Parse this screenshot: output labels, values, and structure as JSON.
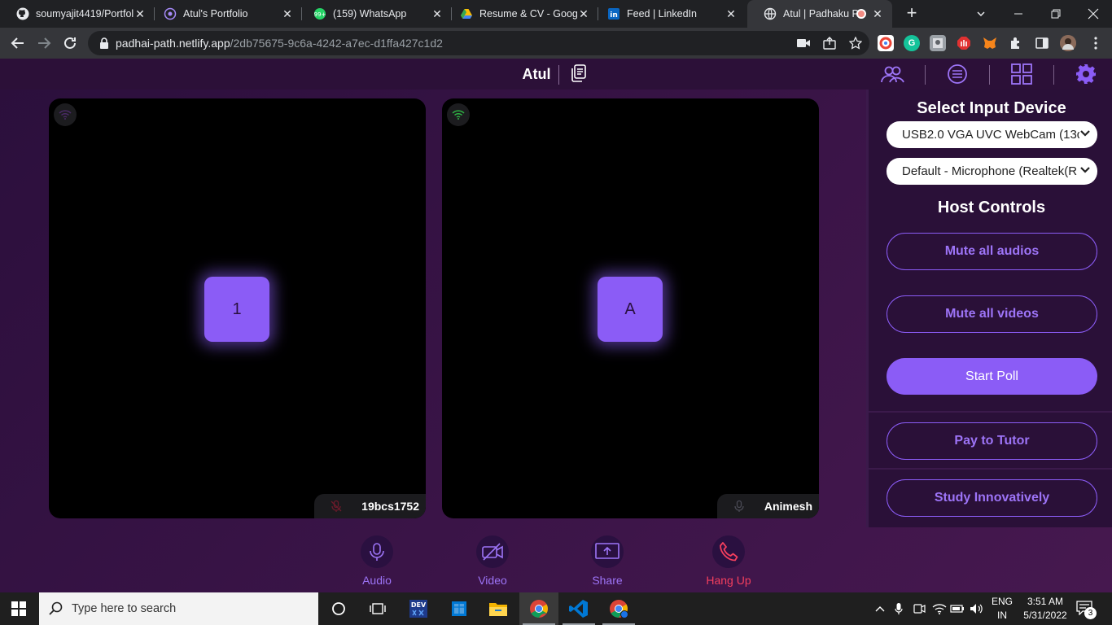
{
  "browser": {
    "tabs": [
      {
        "title": "soumyajit4419/Portfol",
        "icon": "github-icon"
      },
      {
        "title": "Atul's Portfolio",
        "icon": "portfolio-icon"
      },
      {
        "title": "(159) WhatsApp",
        "icon": "whatsapp-icon"
      },
      {
        "title": "Resume & CV - Googl",
        "icon": "google-drive-icon"
      },
      {
        "title": "Feed | LinkedIn",
        "icon": "linkedin-icon"
      },
      {
        "title": "Atul | Padhaku Pa",
        "icon": "globe-icon",
        "active": true
      }
    ],
    "url_host": "padhai-path.netlify.app",
    "url_path": "/2db75675-9c6a-4242-a7ec-d1ffa427c1d2"
  },
  "app": {
    "host_name": "Atul",
    "participants": [
      {
        "avatar": "1",
        "name": "19bcs1752",
        "mic": "muted",
        "signal": "weak"
      },
      {
        "avatar": "A",
        "name": "Animesh",
        "mic": "on",
        "signal": "strong"
      }
    ],
    "panel_tabs": [
      "participants-icon",
      "chat-icon",
      "grid-icon",
      "settings-icon"
    ],
    "settings": {
      "input_heading": "Select Input Device",
      "camera": "USB2.0 VGA UVC WebCam (13d",
      "microphone": "Default - Microphone (Realtek(R",
      "host_heading": "Host Controls",
      "mute_audios": "Mute all audios",
      "mute_videos": "Mute all videos",
      "start_poll": "Start Poll",
      "pay_tutor": "Pay to Tutor",
      "study": "Study Innovatively"
    },
    "controls": {
      "audio": "Audio",
      "video": "Video",
      "share": "Share",
      "hangup": "Hang Up"
    },
    "colors": {
      "accent": "#8b5cf6",
      "danger": "#f43f5e"
    }
  },
  "taskbar": {
    "search_placeholder": "Type here to search",
    "lang_top": "ENG",
    "lang_bottom": "IN",
    "time": "3:51 AM",
    "date": "5/31/2022",
    "notifications": "3"
  }
}
